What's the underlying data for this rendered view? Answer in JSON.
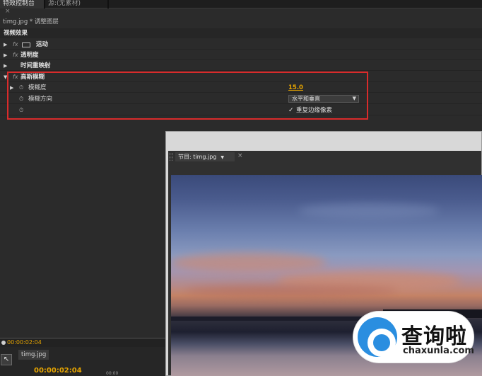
{
  "tabs": {
    "active": "特效控制台",
    "inactive": "源:(无素材)",
    "close_glyph": "×"
  },
  "clip_path": "timg.jpg * 调整图层",
  "section_title": "视频效果",
  "effects": [
    {
      "label": "运动",
      "expanded": false
    },
    {
      "label": "透明度",
      "expanded": false
    },
    {
      "label": "时间重映射",
      "expanded": false
    },
    {
      "label": "高斯模糊",
      "expanded": true
    }
  ],
  "gaussian_blur": {
    "blurriness_label": "模糊度",
    "blurriness_value": "15.0",
    "direction_label": "模糊方向",
    "direction_value": "水平和垂直",
    "repeat_edge_label": "重复边缘像素",
    "repeat_edge_checked": true
  },
  "timecode_bar": "00:00:02:04",
  "timeline": {
    "tab_label": "timg.jpg",
    "timecode": "00:00:02:04",
    "ruler_tick": "00:00"
  },
  "program_monitor": {
    "tab_label": "节目: timg.jpg",
    "close_glyph": "×"
  },
  "watermark": {
    "chinese": "查询啦",
    "url": "chaxunla.com"
  },
  "colors": {
    "accent_value": "#e6a400",
    "highlight_box": "#d92b2b",
    "logo_blue": "#2a8ee0"
  }
}
